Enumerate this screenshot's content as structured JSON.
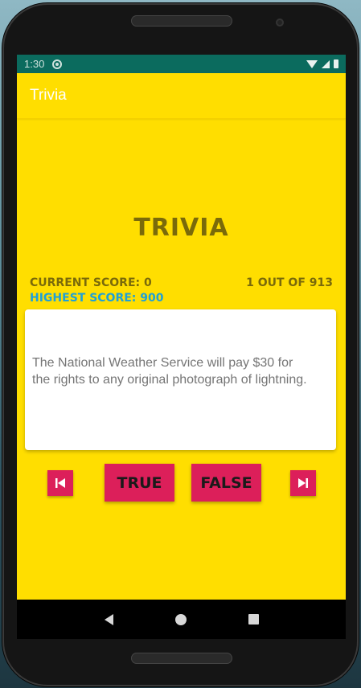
{
  "status_bar": {
    "time": "1:30"
  },
  "app_bar": {
    "title": "Trivia"
  },
  "game": {
    "heading": "TRIVIA",
    "current_score": "CURRENT SCORE: 0",
    "question_counter": "1 OUT OF 913",
    "highest_score": "HIGHEST SCORE: 900",
    "question": "The National Weather Service will pay $30 for the rights to any original photograph of lightning."
  },
  "buttons": {
    "true_label": "TRUE",
    "false_label": "FALSE",
    "prev_icon": "skip-previous-icon",
    "next_icon": "skip-next-icon"
  },
  "colors": {
    "background": "#ffde00",
    "heading_text": "#7a6a0a",
    "highest_score_text": "#1ea0d8",
    "button": "#dc1f5a",
    "status_bar": "#0b6b5e"
  }
}
